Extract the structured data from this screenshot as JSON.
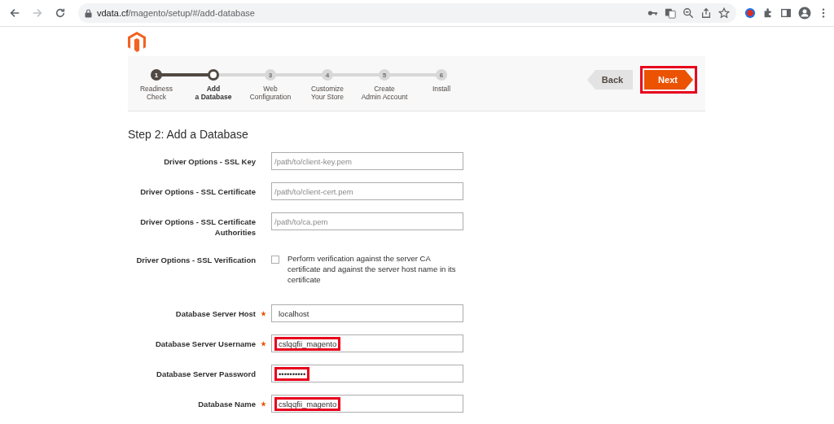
{
  "browser": {
    "url_host": "vdata.cf",
    "url_path": "/magento/setup/#/add-database",
    "forward_disabled": true
  },
  "wizard": {
    "steps": [
      {
        "number": "1",
        "label": "Readiness\nCheck",
        "kind": "done"
      },
      {
        "label": "Add\na Database",
        "kind": "current"
      },
      {
        "number": "3",
        "label": "Web\nConfiguration",
        "kind": "upcoming"
      },
      {
        "number": "4",
        "label": "Customize\nYour Store",
        "kind": "upcoming"
      },
      {
        "number": "5",
        "label": "Create\nAdmin Account",
        "kind": "upcoming"
      },
      {
        "number": "6",
        "label": "Install",
        "kind": "upcoming"
      }
    ],
    "back_button": {
      "label": "Back",
      "highlighted": false
    },
    "next_button": {
      "label": "Next",
      "highlighted": true
    }
  },
  "heading": "Step 2: Add a Database",
  "fields": [
    {
      "kind": "text",
      "label": "Driver Options - SSL Key",
      "required": false,
      "placeholder": "/path/to/client-key.pem"
    },
    {
      "kind": "text",
      "label": "Driver Options - SSL Certificate",
      "required": false,
      "placeholder": "/path/to/client-cert.pem"
    },
    {
      "kind": "text",
      "label": "Driver Options - SSL Certificate Authorities",
      "required": false,
      "placeholder": "/path/to/ca.pem"
    },
    {
      "kind": "checkbox",
      "label": "Driver Options - SSL Verification",
      "checked": false,
      "text": "Perform verification against the server CA certificate and against the server host name in its certificate"
    },
    {
      "kind": "text",
      "label": "Database Server Host",
      "required": true,
      "value": "localhost",
      "highlighted": false
    },
    {
      "kind": "text",
      "label": "Database Server Username",
      "required": true,
      "value": "cslqqfii_magento",
      "highlighted": true
    },
    {
      "kind": "password",
      "label": "Database Server Password",
      "required": false,
      "value": "••••••••••",
      "highlighted": true
    },
    {
      "kind": "text",
      "label": "Database Name",
      "required": true,
      "value": "cslqqfii_magento",
      "highlighted": true
    }
  ]
}
